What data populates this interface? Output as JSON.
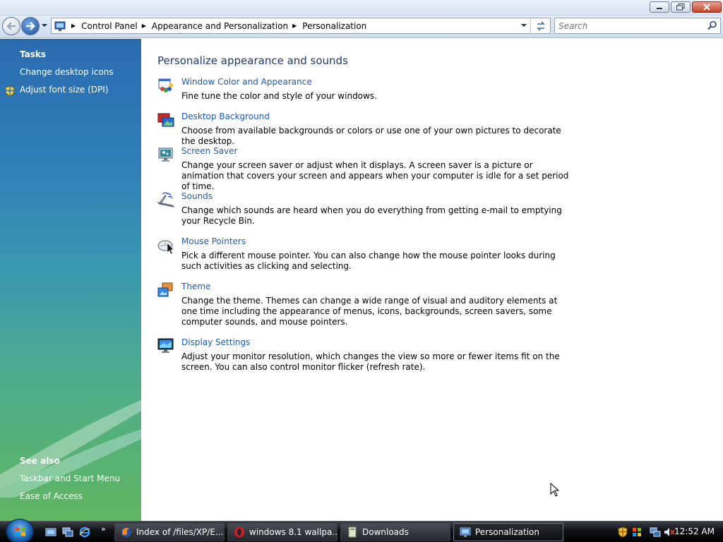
{
  "window": {
    "caption_buttons": [
      "minimize-icon",
      "maximize-icon",
      "close-icon"
    ]
  },
  "navigation": {
    "breadcrumbs": [
      "Control Panel",
      "Appearance and Personalization",
      "Personalization"
    ],
    "search": {
      "placeholder": "Search",
      "value": ""
    }
  },
  "tasks_pane": {
    "tasks_heading": "Tasks",
    "tasks": [
      {
        "label": "Change desktop icons",
        "icon": ""
      },
      {
        "label": "Adjust font size (DPI)",
        "icon": "shield-icon"
      }
    ],
    "see_also_heading": "See also",
    "see_also": [
      "Taskbar and Start Menu",
      "Ease of Access"
    ]
  },
  "main": {
    "title": "Personalize appearance and sounds",
    "items": [
      {
        "link": "Window Color and Appearance",
        "desc": "Fine tune the color and style of your windows.",
        "icon": "window-color-icon"
      },
      {
        "link": "Desktop Background",
        "desc": "Choose from available backgrounds or colors or use one of your own pictures to decorate the desktop.",
        "icon": "desktop-background-icon"
      },
      {
        "link": "Screen Saver",
        "desc": "Change your screen saver or adjust when it displays. A screen saver is a picture or animation that covers your screen and appears when your computer is idle for a set period of time.",
        "icon": "screen-saver-icon"
      },
      {
        "link": "Sounds",
        "desc": "Change which sounds are heard when you do everything from getting e-mail to emptying your Recycle Bin.",
        "icon": "sounds-icon"
      },
      {
        "link": "Mouse Pointers",
        "desc": "Pick a different mouse pointer. You can also change how the mouse pointer looks during such activities as clicking and selecting.",
        "icon": "mouse-icon"
      },
      {
        "link": "Theme",
        "desc": "Change the theme. Themes can change a wide range of visual and auditory elements at one time including the appearance of menus, icons, backgrounds, screen savers, some computer sounds, and mouse pointers.",
        "icon": "theme-icon"
      },
      {
        "link": "Display Settings",
        "desc": "Adjust your monitor resolution, which changes the view so more or fewer items fit on the screen. You can also control monitor flicker (refresh rate).",
        "icon": "display-settings-icon"
      }
    ]
  },
  "taskbar": {
    "quick_launch": [
      "show-desktop-icon",
      "switch-windows-icon",
      "internet-explorer-icon"
    ],
    "quick_launch_more": "»",
    "buttons": [
      {
        "label": "Index of /files/XP/E...",
        "icon": "firefox-icon",
        "active": false
      },
      {
        "label": "windows 8.1 wallpa...",
        "icon": "opera-icon",
        "active": false
      },
      {
        "label": "Downloads",
        "icon": "folder-icon",
        "active": false
      },
      {
        "label": "Personalization",
        "icon": "control-panel-icon",
        "active": true
      }
    ],
    "tray_icons": [
      "security-shield-icon",
      "windows-update-icon",
      "network-icon",
      "volume-muted-icon"
    ],
    "clock": "12:52 AM"
  },
  "colors": {
    "link": "#1f5bb5",
    "title": "#1e3a6e",
    "pane_top": "#2b6bb0",
    "pane_bottom": "#5fb560"
  }
}
